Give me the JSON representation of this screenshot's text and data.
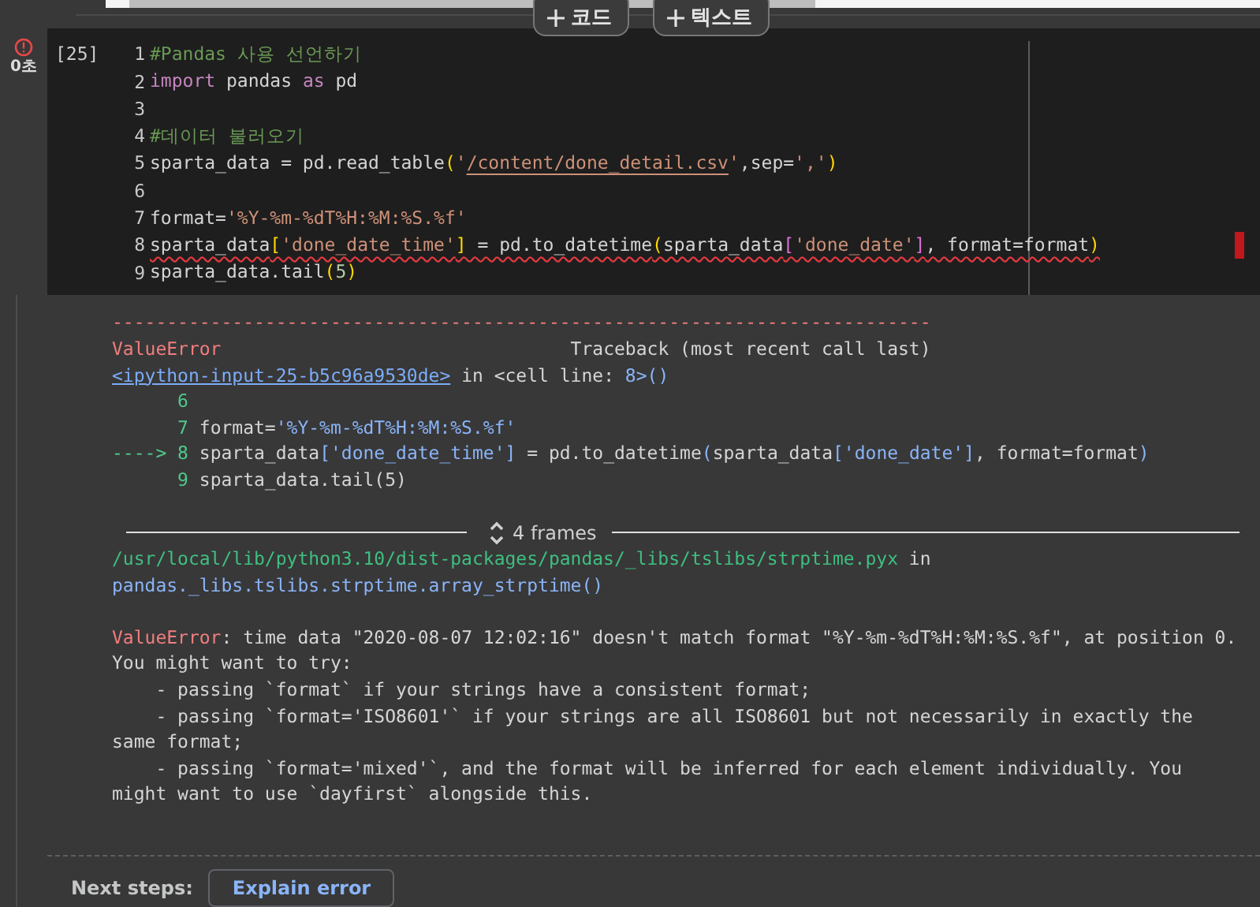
{
  "add_buttons": [
    {
      "label": "코드"
    },
    {
      "label": "텍스트"
    }
  ],
  "cell": {
    "duration": "0초",
    "execution_count": "[25]",
    "code_lines": [
      {
        "number": "1",
        "tokens": [
          {
            "kind": "comment",
            "text": "#Pandas 사용 선언하기"
          }
        ]
      },
      {
        "number": "2",
        "tokens": [
          {
            "kind": "keyword",
            "text": "import"
          },
          {
            "kind": "plain",
            "text": " pandas "
          },
          {
            "kind": "keyword",
            "text": "as"
          },
          {
            "kind": "plain",
            "text": " pd"
          }
        ]
      },
      {
        "number": "3"
      },
      {
        "number": "4",
        "tokens": [
          {
            "kind": "comment",
            "text": "#데이터 불러오기"
          }
        ]
      },
      {
        "number": "5",
        "tokens": [
          {
            "kind": "plain",
            "text": "sparta_data = pd.read_table"
          },
          {
            "kind": "bracket",
            "text": "("
          },
          {
            "kind": "string",
            "text": "'"
          },
          {
            "kind": "link",
            "text": "/content/done_detail.csv"
          },
          {
            "kind": "string",
            "text": "'"
          },
          {
            "kind": "plain",
            "text": ",sep="
          },
          {
            "kind": "string",
            "text": "','"
          },
          {
            "kind": "bracket",
            "text": ")"
          }
        ]
      },
      {
        "number": "6"
      },
      {
        "number": "7",
        "tokens": [
          {
            "kind": "plain",
            "text": "format="
          },
          {
            "kind": "string",
            "text": "'%Y-%m-%dT%H:%M:%S.%f'"
          }
        ]
      },
      {
        "number": "8",
        "underlined": true,
        "tokens": [
          {
            "kind": "plain",
            "text": "sparta_data"
          },
          {
            "kind": "bracket",
            "text": "["
          },
          {
            "kind": "string",
            "text": "'done_date_time'"
          },
          {
            "kind": "bracket",
            "text": "]"
          },
          {
            "kind": "plain",
            "text": " = pd.to_datetime"
          },
          {
            "kind": "bracket",
            "text": "("
          },
          {
            "kind": "plain",
            "text": "sparta_data"
          },
          {
            "kind": "bracket2",
            "text": "["
          },
          {
            "kind": "string",
            "text": "'done_date'"
          },
          {
            "kind": "bracket2",
            "text": "]"
          },
          {
            "kind": "plain",
            "text": ", format=format"
          },
          {
            "kind": "bracket",
            "text": ")"
          }
        ]
      },
      {
        "number": "9",
        "tokens": [
          {
            "kind": "plain",
            "text": "sparta_data.tail"
          },
          {
            "kind": "bracket",
            "text": "("
          },
          {
            "kind": "number",
            "text": "5"
          },
          {
            "kind": "bracket",
            "text": ")"
          }
        ]
      }
    ]
  },
  "output": {
    "traceback": [
      {
        "tokens": [
          {
            "kind": "error",
            "text": "---------------------------------------------------------------------------"
          }
        ]
      },
      {
        "tokens": [
          {
            "kind": "error",
            "text": "ValueError"
          },
          {
            "kind": "plain",
            "text": "                                Traceback (most recent call last)"
          }
        ]
      },
      {
        "tokens": [
          {
            "kind": "link",
            "text": "<ipython-input-25-b5c96a9530de>"
          },
          {
            "kind": "plain",
            "text": " in <cell line: "
          },
          {
            "kind": "blue",
            "text": "8>()"
          }
        ]
      },
      {
        "tokens": [
          {
            "kind": "lineno",
            "text": "      6"
          }
        ]
      },
      {
        "tokens": [
          {
            "kind": "lineno",
            "text": "      7"
          },
          {
            "kind": "plain",
            "text": " format="
          },
          {
            "kind": "blue",
            "text": "'%Y-%m-%dT%H:%M:%S.%f'"
          }
        ]
      },
      {
        "tokens": [
          {
            "kind": "lineno",
            "text": "----> 8"
          },
          {
            "kind": "plain",
            "text": " sparta_data"
          },
          {
            "kind": "blue",
            "text": "['done_date_time']"
          },
          {
            "kind": "plain",
            "text": " = pd.to_datetime"
          },
          {
            "kind": "blue",
            "text": "("
          },
          {
            "kind": "plain",
            "text": "sparta_data"
          },
          {
            "kind": "blue",
            "text": "['done_date']"
          },
          {
            "kind": "plain",
            "text": ", format=format"
          },
          {
            "kind": "blue",
            "text": ")"
          }
        ]
      },
      {
        "tokens": [
          {
            "kind": "lineno",
            "text": "      9"
          },
          {
            "kind": "plain",
            "text": " sparta_data.tail(5)"
          }
        ]
      }
    ],
    "frames_label": "4 frames",
    "frame": [
      {
        "tokens": [
          {
            "kind": "path",
            "text": "/usr/local/lib/python3.10/dist-packages/pandas/_libs/tslibs/strptime.pyx"
          },
          {
            "kind": "plain",
            "text": " in"
          }
        ]
      },
      {
        "tokens": [
          {
            "kind": "blue",
            "text": "pandas._libs.tslibs.strptime.array_strptime()"
          }
        ]
      }
    ],
    "message": [
      {
        "tokens": [
          {
            "kind": "error",
            "text": "ValueError"
          },
          {
            "kind": "plain",
            "text": ": time data \"2020-08-07 12:02:16\" doesn't match format \"%Y-%m-%dT%H:%M:%S.%f\", at position 0."
          }
        ]
      },
      {
        "tokens": [
          {
            "kind": "plain",
            "text": "You might want to try:"
          }
        ]
      },
      {
        "tokens": [
          {
            "kind": "plain",
            "text": "    - passing `format` if your strings have a consistent format;"
          }
        ]
      },
      {
        "tokens": [
          {
            "kind": "plain",
            "text": "    - passing `format='ISO8601'` if your strings are all ISO8601 but not necessarily in exactly the"
          }
        ]
      },
      {
        "tokens": [
          {
            "kind": "plain",
            "text": "same format;"
          }
        ]
      },
      {
        "tokens": [
          {
            "kind": "plain",
            "text": "    - passing `format='mixed'`, and the format will be inferred for each element individually. You"
          }
        ]
      },
      {
        "tokens": [
          {
            "kind": "plain",
            "text": "might want to use `dayfirst` alongside this."
          }
        ]
      }
    ]
  },
  "next_steps": {
    "label": "Next steps:",
    "buttons": [
      {
        "label": "Explain error"
      }
    ]
  }
}
